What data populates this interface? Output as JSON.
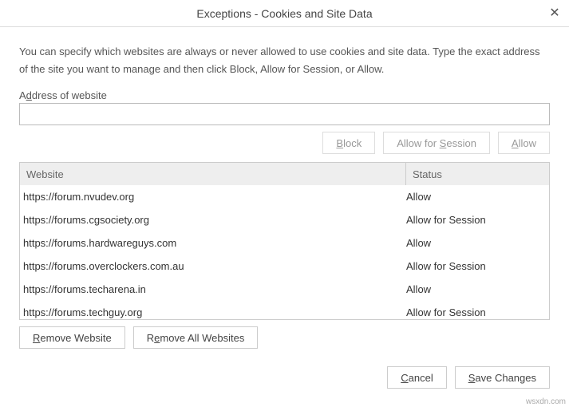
{
  "title": "Exceptions - Cookies and Site Data",
  "intro": "You can specify which websites are always or never allowed to use cookies and site data. Type the exact address of the site you want to manage and then click Block, Allow for Session, or Allow.",
  "address": {
    "label_pre": "A",
    "label_u": "d",
    "label_post": "dress of website",
    "value": ""
  },
  "buttons": {
    "block_pre": "",
    "block_u": "B",
    "block_post": "lock",
    "session_pre": "Allow for ",
    "session_u": "S",
    "session_post": "ession",
    "allow_pre": "",
    "allow_u": "A",
    "allow_post": "llow",
    "remove_pre": "",
    "remove_u": "R",
    "remove_post": "emove Website",
    "remove_all_pre": "R",
    "remove_all_u": "e",
    "remove_all_post": "move All Websites",
    "cancel_pre": "",
    "cancel_u": "C",
    "cancel_post": "ancel",
    "save_pre": "",
    "save_u": "S",
    "save_post": "ave Changes"
  },
  "table": {
    "headers": {
      "website": "Website",
      "status": "Status"
    },
    "rows": [
      {
        "website": "https://forum.nvudev.org",
        "status": "Allow"
      },
      {
        "website": "https://forums.cgsociety.org",
        "status": "Allow for Session"
      },
      {
        "website": "https://forums.hardwareguys.com",
        "status": "Allow"
      },
      {
        "website": "https://forums.overclockers.com.au",
        "status": "Allow for Session"
      },
      {
        "website": "https://forums.techarena.in",
        "status": "Allow"
      },
      {
        "website": "https://forums.techguy.org",
        "status": "Allow for Session"
      }
    ]
  },
  "watermark": "wsxdn.com"
}
